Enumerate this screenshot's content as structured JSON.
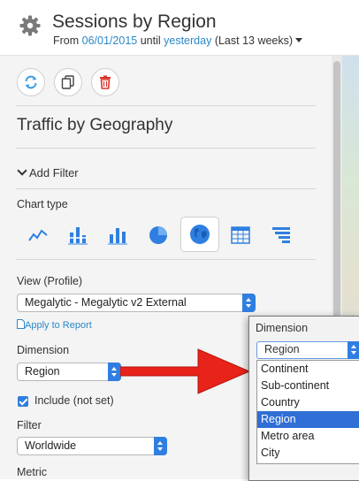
{
  "header": {
    "title": "Sessions by Region",
    "date_prefix": "From",
    "date_start": "06/01/2015",
    "date_middle": "until",
    "date_end": "yesterday",
    "date_range": "(Last 13 weeks)"
  },
  "toolbar": {
    "refresh_icon": "refresh-icon",
    "duplicate_icon": "duplicate-icon",
    "delete_icon": "trash-icon"
  },
  "widget": {
    "title": "Traffic by Geography",
    "add_filter_label": "Add Filter",
    "chart_type_label": "Chart type",
    "chart_types": [
      "line",
      "stacked-bar",
      "bar",
      "pie",
      "geo-map",
      "table",
      "funnel"
    ],
    "chart_type_selected": "geo-map",
    "view_label": "View (Profile)",
    "view_value": "Megalytic - Megalytic v2 External",
    "apply_label": "Apply to Report",
    "dimension_label": "Dimension",
    "dimension_value": "Region",
    "include_label": "Include (not set)",
    "include_checked": true,
    "filter_label": "Filter",
    "filter_value": "Worldwide",
    "metric_label": "Metric"
  },
  "dimension_popup": {
    "label": "Dimension",
    "selected": "Region",
    "options": [
      "Continent",
      "Sub-continent",
      "Country",
      "Region",
      "Metro area",
      "City"
    ]
  },
  "colors": {
    "accent": "#2f7fe0",
    "link": "#2a88c8",
    "arrow": "#e8231a",
    "panel_bg": "#f4f4f4"
  }
}
